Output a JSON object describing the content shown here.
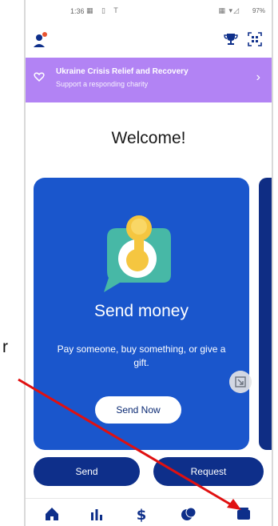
{
  "status_bar": {
    "time": "1:36",
    "left_icons": "▦ ▯ T",
    "right_icons": "▦ ▾◿",
    "battery": "97%"
  },
  "banner": {
    "title": "Ukraine Crisis Relief and Recovery",
    "subtitle": "Support a responding charity",
    "color": "#b283f4"
  },
  "welcome": "Welcome!",
  "card": {
    "title": "Send money",
    "description": "Pay someone, buy something, or give a gift.",
    "button_label": "Send Now",
    "color": "#1a56cc"
  },
  "actions": {
    "send_label": "Send",
    "request_label": "Request",
    "color": "#0e2f8a"
  },
  "bottom_nav": [
    {
      "icon": "home-icon"
    },
    {
      "icon": "activity-chart-icon"
    },
    {
      "icon": "dollar-icon"
    },
    {
      "icon": "crypto-icon"
    },
    {
      "icon": "wallet-icon"
    }
  ],
  "left_mark": "r",
  "annotation_color": "#e01010"
}
